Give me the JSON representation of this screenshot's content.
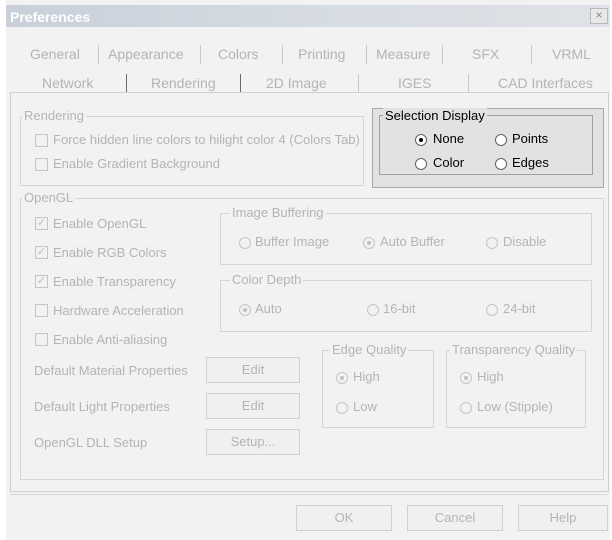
{
  "window": {
    "title": "Preferences",
    "close_glyph": "×"
  },
  "tabs": {
    "row1": [
      "General",
      "Appearance",
      "Colors",
      "Printing",
      "Measure",
      "SFX",
      "VRML"
    ],
    "row2": [
      "Network",
      "Rendering",
      "2D Image",
      "IGES",
      "CAD Interfaces"
    ],
    "active": "Rendering"
  },
  "rendering": {
    "label": "Rendering",
    "force_hidden": {
      "label": "Force hidden line colors to hilight color 4 (Colors Tab)",
      "checked": false
    },
    "gradient": {
      "label": "Enable Gradient Background",
      "checked": false
    }
  },
  "selection_display": {
    "label": "Selection Display",
    "none": "None",
    "points": "Points",
    "color": "Color",
    "edges": "Edges",
    "selected": "None"
  },
  "opengl": {
    "label": "OpenGL",
    "enable_opengl": {
      "label": "Enable OpenGL",
      "checked": true
    },
    "enable_rgb": {
      "label": "Enable RGB Colors",
      "checked": true
    },
    "enable_transparency": {
      "label": "Enable Transparency",
      "checked": true
    },
    "hardware_accel": {
      "label": "Hardware Acceleration",
      "checked": false
    },
    "anti_aliasing": {
      "label": "Enable Anti-aliasing",
      "checked": false
    },
    "default_material": "Default Material Properties",
    "default_light": "Default Light Properties",
    "dll_setup": "OpenGL DLL Setup",
    "edit_label": "Edit",
    "setup_label": "Setup...",
    "image_buffering": {
      "label": "Image Buffering",
      "buffer_image": "Buffer Image",
      "auto_buffer": "Auto Buffer",
      "disable": "Disable",
      "selected": "Auto Buffer"
    },
    "color_depth": {
      "label": "Color Depth",
      "auto": "Auto",
      "bit16": "16-bit",
      "bit24": "24-bit",
      "selected": "Auto"
    },
    "edge_quality": {
      "label": "Edge Quality",
      "high": "High",
      "low": "Low",
      "selected": "High"
    },
    "transparency_quality": {
      "label": "Transparency Quality",
      "high": "High",
      "low": "Low (Stipple)",
      "selected": "High"
    }
  },
  "footer": {
    "ok": "OK",
    "cancel": "Cancel",
    "help": "Help"
  },
  "colors": {
    "disabled_text": "#b4b4b4",
    "title_gradient_start": "#c9d0da",
    "highlight_group": "#e3e1e3"
  }
}
